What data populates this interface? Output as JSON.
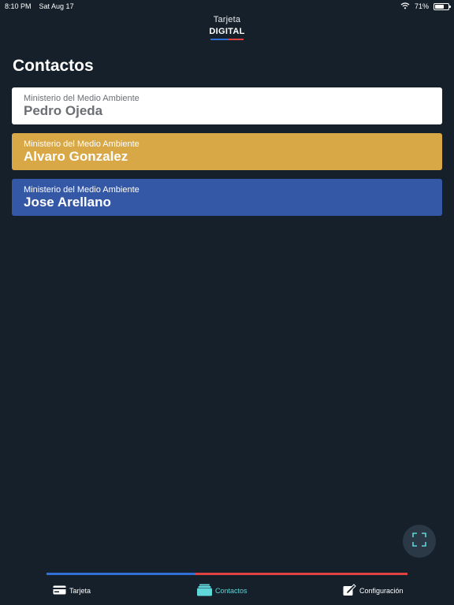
{
  "status_bar": {
    "time": "8:10 PM",
    "date": "Sat Aug 17",
    "battery": "71%",
    "battery_level": 0.71
  },
  "logo": {
    "line1": "Tarjeta",
    "line2": "DIGITAL"
  },
  "page": {
    "title": "Contactos"
  },
  "contacts": [
    {
      "organization": "Ministerio del Medio Ambiente",
      "name": "Pedro Ojeda",
      "color": "#ffffff"
    },
    {
      "organization": "Ministerio del Medio Ambiente",
      "name": "Alvaro Gonzalez",
      "color": "#d9a846"
    },
    {
      "organization": "Ministerio del Medio Ambiente",
      "name": "Jose Arellano",
      "color": "#3558a6"
    }
  ],
  "fab": {
    "icon": "scan-icon"
  },
  "tabs": [
    {
      "label": "Tarjeta",
      "icon": "card-icon",
      "active": false
    },
    {
      "label": "Contactos",
      "icon": "contacts-stack-icon",
      "active": true
    },
    {
      "label": "Configuración",
      "icon": "edit-icon",
      "active": false
    }
  ],
  "colors": {
    "background": "#16202a",
    "active_tab": "#5fd6d8",
    "accent_blue": "#2f6fd6",
    "accent_red": "#e04242"
  }
}
